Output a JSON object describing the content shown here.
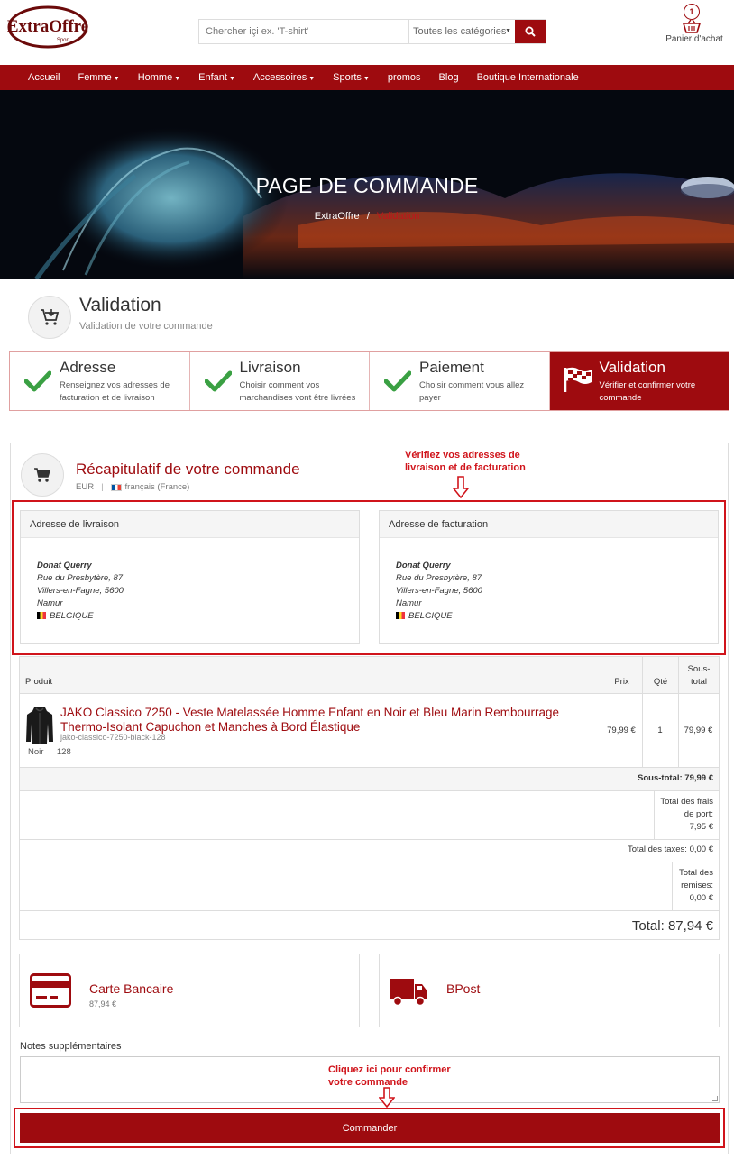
{
  "header": {
    "logo_text": "ExtraOffre",
    "logo_sub": "Sport",
    "search_placeholder": "Chercher içi ex. 'T-shirt'",
    "category_select": "Toutes les catégories",
    "cart_count": "1",
    "cart_label": "Panier d'achat"
  },
  "nav": {
    "items": [
      {
        "label": "Accueil",
        "dropdown": false
      },
      {
        "label": "Femme",
        "dropdown": true
      },
      {
        "label": "Homme",
        "dropdown": true
      },
      {
        "label": "Enfant",
        "dropdown": true
      },
      {
        "label": "Accessoires",
        "dropdown": true
      },
      {
        "label": "Sports",
        "dropdown": true
      },
      {
        "label": "promos",
        "dropdown": false
      },
      {
        "label": "Blog",
        "dropdown": false
      },
      {
        "label": "Boutique Internationale",
        "dropdown": false
      }
    ]
  },
  "hero": {
    "title": "PAGE DE COMMANDE",
    "breadcrumb_home": "ExtraOffre",
    "breadcrumb_sep": "/",
    "breadcrumb_current": "Validation"
  },
  "page": {
    "title": "Validation",
    "subtitle": "Validation de votre commande"
  },
  "steps": [
    {
      "title": "Adresse",
      "desc": "Renseignez vos adresses de facturation et de livraison",
      "done": true
    },
    {
      "title": "Livraison",
      "desc": "Choisir comment vos marchandises vont être livrées",
      "done": true
    },
    {
      "title": "Paiement",
      "desc": "Choisir comment vous allez payer",
      "done": true
    },
    {
      "title": "Validation",
      "desc": "Vérifier et confirmer votre commande",
      "done": false
    }
  ],
  "summary": {
    "title": "Récapitulatif de votre commande",
    "currency": "EUR",
    "language": "français (France)"
  },
  "annotations": {
    "addresses_line1": "Vérifiez vos adresses de",
    "addresses_line2": "livraison et de facturation",
    "confirm_line1": "Cliquez ici pour confirmer",
    "confirm_line2": "votre commande"
  },
  "shipping_address": {
    "heading": "Adresse de livraison",
    "name": "Donat Querry",
    "street": "Rue du Presbytère, 87",
    "city": "Villers-en-Fagne, 5600",
    "region": "Namur",
    "country": "BELGIQUE"
  },
  "billing_address": {
    "heading": "Adresse de facturation",
    "name": "Donat Querry",
    "street": "Rue du Presbytère, 87",
    "city": "Villers-en-Fagne, 5600",
    "region": "Namur",
    "country": "BELGIQUE"
  },
  "table": {
    "col_product": "Produit",
    "col_price": "Prix",
    "col_qty": "Qté",
    "col_subtotal_1": "Sous-",
    "col_subtotal_2": "total",
    "product": {
      "name_line1": "JAKO Classico 7250 - Veste Matelassée Homme Enfant en Noir et Bleu Marin Rembourrage",
      "name_line2": "Thermo-Isolant Capuchon et Manches à Bord Élastique",
      "ref": "jako-classico-7250-black-128",
      "color": "Noir",
      "size": "128",
      "price": "79,99 €",
      "qty": "1",
      "subtotal": "79,99 €"
    },
    "subtotal_line": "Sous-total: 79,99 €",
    "shipping_1": "Total des frais",
    "shipping_2": "de port:",
    "shipping_3": "7,95 €",
    "taxes_line": "Total des taxes: 0,00 €",
    "discounts_1": "Total des",
    "discounts_2": "remises:",
    "discounts_3": "0,00 €",
    "grand_total": "Total: 87,94 €"
  },
  "payment": {
    "method": "Carte Bancaire",
    "amount": "87,94 €",
    "carrier": "BPost"
  },
  "notes": {
    "label": "Notes supplémentaires",
    "value": ""
  },
  "order_button": "Commander"
}
